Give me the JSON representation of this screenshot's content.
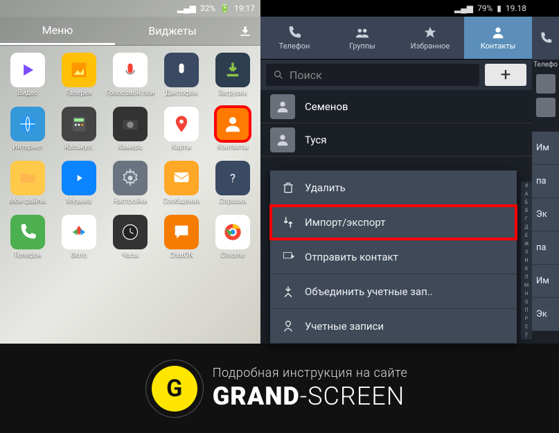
{
  "left": {
    "status": {
      "signal": "📶",
      "battery_pct": "32%",
      "time": "19:17"
    },
    "tabs": {
      "menu": "Меню",
      "widgets": "Виджеты"
    },
    "apps": [
      {
        "label": "Видео",
        "name": "video-icon",
        "bg": "#fff"
      },
      {
        "label": "Галерея",
        "name": "gallery-icon",
        "bg": "#ffc107"
      },
      {
        "label": "Голосовой поиск",
        "name": "voice-search-icon",
        "bg": "#fff"
      },
      {
        "label": "Диктофон",
        "name": "recorder-icon",
        "bg": "#3a4a63"
      },
      {
        "label": "Загрузки",
        "name": "downloads-icon",
        "bg": "#2c3e50"
      },
      {
        "label": "Интернет",
        "name": "internet-icon",
        "bg": "#3498db"
      },
      {
        "label": "Калькул.",
        "name": "calculator-icon",
        "bg": "#444"
      },
      {
        "label": "Камера",
        "name": "camera-icon",
        "bg": "#333"
      },
      {
        "label": "Карты",
        "name": "maps-icon",
        "bg": "#fff"
      },
      {
        "label": "Контакты",
        "name": "contacts-icon",
        "bg": "#ff7a00",
        "hl": true
      },
      {
        "label": "Мои файлы",
        "name": "files-icon",
        "bg": "#ffc94a"
      },
      {
        "label": "Музыка",
        "name": "music-icon",
        "bg": "#0a84ff"
      },
      {
        "label": "Настройки",
        "name": "settings-icon",
        "bg": "#6a7480"
      },
      {
        "label": "Сообщения",
        "name": "messages-icon",
        "bg": "#ffa726"
      },
      {
        "label": "Справка",
        "name": "help-icon",
        "bg": "#3a4a63"
      },
      {
        "label": "Телефон",
        "name": "phone-icon",
        "bg": "#4caf50"
      },
      {
        "label": "Фото",
        "name": "photos-icon",
        "bg": "#fff"
      },
      {
        "label": "Часы",
        "name": "clock-icon",
        "bg": "#333"
      },
      {
        "label": "ChatON",
        "name": "chaton-icon",
        "bg": "#f57c00"
      },
      {
        "label": "Chrome",
        "name": "chrome-icon",
        "bg": "#fff"
      }
    ]
  },
  "right": {
    "status": {
      "battery_pct": "79%",
      "time": "19.18"
    },
    "tabs": [
      {
        "label": "Телефон",
        "name": "tab-phone"
      },
      {
        "label": "Группы",
        "name": "tab-groups"
      },
      {
        "label": "Избранное",
        "name": "tab-favorites"
      },
      {
        "label": "Контакты",
        "name": "tab-contacts",
        "active": true
      }
    ],
    "search_placeholder": "Поиск",
    "contacts": [
      "Семенов",
      "Туся"
    ],
    "menu": [
      {
        "label": "Удалить",
        "name": "menu-delete"
      },
      {
        "label": "Импорт/экспорт",
        "name": "menu-import-export",
        "hl": true
      },
      {
        "label": "Отправить контакт",
        "name": "menu-send-contact"
      },
      {
        "label": "Объединить учетные зап..",
        "name": "menu-merge-accounts"
      },
      {
        "label": "Учетные записи",
        "name": "menu-accounts"
      }
    ],
    "alpha_index": "#АБВГДЕЖЗИКЛМНОПРСТ"
  },
  "third": {
    "tab": "Телефо",
    "menu": [
      "Им",
      "па",
      "Эк",
      "па",
      "Им",
      "Эк"
    ]
  },
  "footer": {
    "logo_letter": "G",
    "tagline": "Подробная инструкция на сайте",
    "brand_strong": "GRAND",
    "brand_light": "-SCREEN"
  }
}
